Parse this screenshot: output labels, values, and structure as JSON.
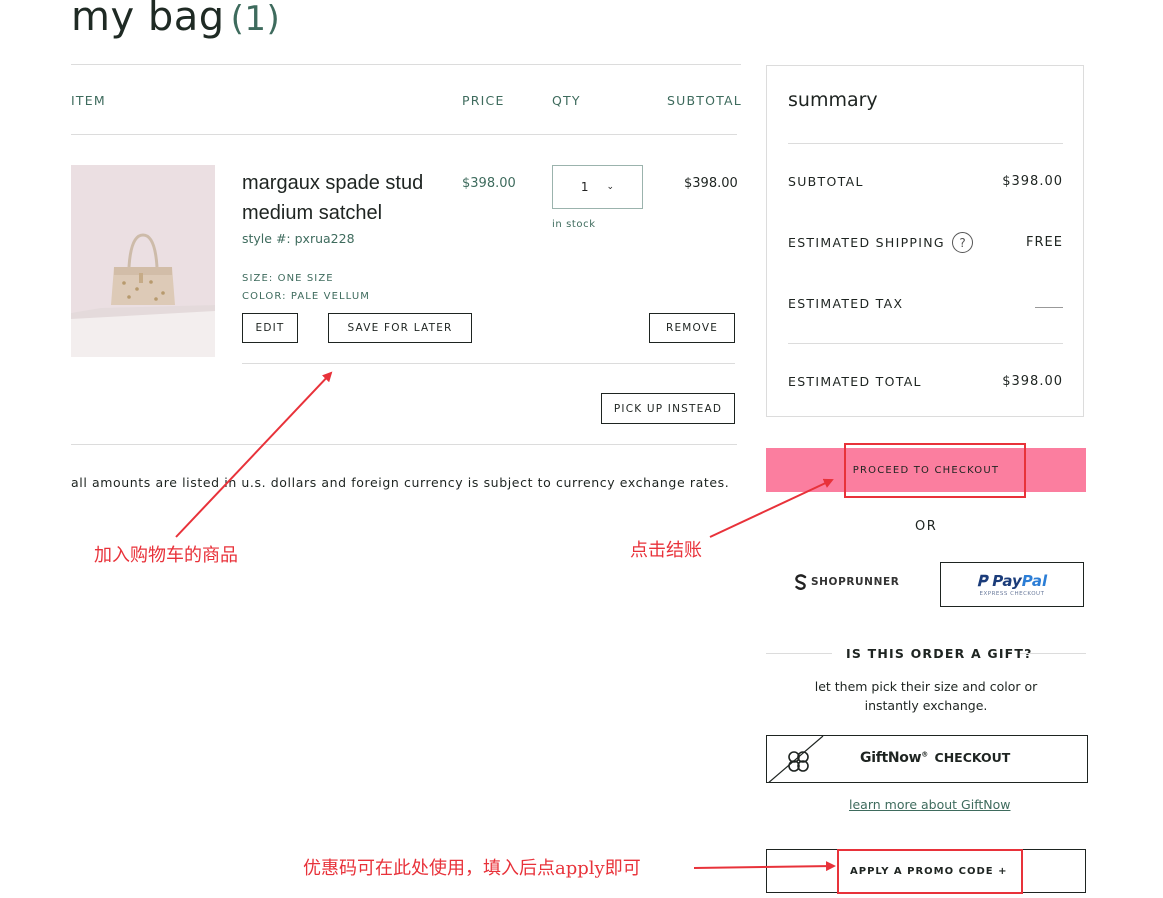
{
  "page": {
    "title": "my bag",
    "count": "(1)"
  },
  "table": {
    "headers": {
      "item": "ITEM",
      "price": "PRICE",
      "qty": "QTY",
      "subtotal": "SUBTOTAL"
    }
  },
  "item": {
    "name": "margaux spade stud medium satchel",
    "style": "style #: pxrua228",
    "size": "SIZE: ONE SIZE",
    "color": "COLOR: PALE VELLUM",
    "price": "$398.00",
    "qty": "1",
    "stock": "in stock",
    "subtotal": "$398.00",
    "buttons": {
      "edit": "EDIT",
      "save_for_later": "SAVE FOR LATER",
      "remove": "REMOVE",
      "pickup": "PICK UP INSTEAD"
    }
  },
  "disclaimer": "all amounts are listed in u.s. dollars and foreign currency is subject to currency exchange rates.",
  "summary": {
    "title": "summary",
    "subtotal_label": "SUBTOTAL",
    "subtotal_value": "$398.00",
    "shipping_label": "ESTIMATED SHIPPING",
    "shipping_help": "?",
    "shipping_value": "FREE",
    "tax_label": "ESTIMATED TAX",
    "total_label": "ESTIMATED TOTAL",
    "total_value": "$398.00"
  },
  "checkout": {
    "proceed": "PROCEED TO CHECKOUT",
    "or": "OR",
    "shoprunner": "SHOPRUNNER",
    "paypal_pay": "Pay",
    "paypal_pal": "Pal",
    "paypal_sub": "EXPRESS CHECKOUT"
  },
  "gift": {
    "heading": "IS THIS ORDER A GIFT?",
    "desc": "let them pick their size and color or instantly exchange.",
    "giftnow": "GiftNow",
    "trademark": "®",
    "checkout": "CHECKOUT",
    "learn_more": "learn more about GiftNow"
  },
  "promo": {
    "label": "APPLY A PROMO CODE  +"
  },
  "annotations": {
    "item_note": "加入购物车的商品",
    "checkout_note": "点击结账",
    "promo_note": "优惠码可在此处使用，填入后点apply即可"
  },
  "colors": {
    "accent_green": "#3e6b5d",
    "checkout_pink": "#fb7e9f",
    "annotation_red": "#e8323a"
  }
}
